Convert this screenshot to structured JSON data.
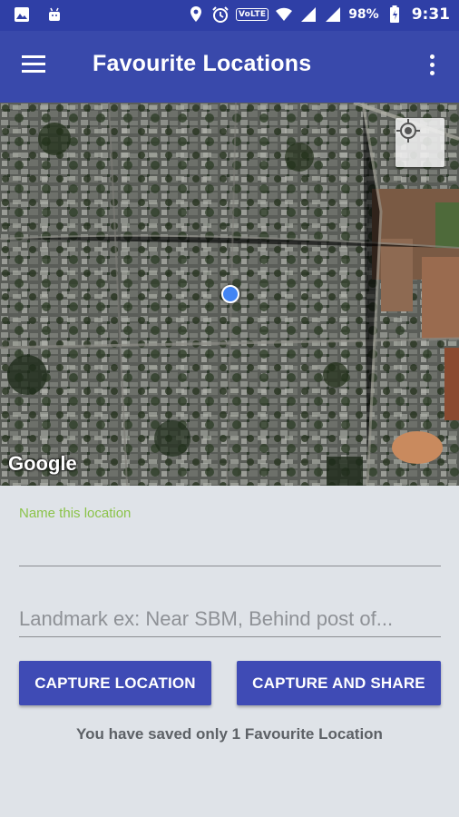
{
  "status_bar": {
    "icons_left": [
      "image-icon",
      "android-icon"
    ],
    "icons_right": [
      "location-icon",
      "alarm-icon",
      "volte-icon",
      "wifi-icon",
      "signal-icon",
      "signal-icon",
      "battery-icon"
    ],
    "volte_label": "VoLTE",
    "battery": "98%",
    "time": "9:31"
  },
  "app_bar": {
    "title": "Favourite Locations"
  },
  "map": {
    "attribution": "Google"
  },
  "form": {
    "name_label": "Name this location",
    "name_value": "",
    "landmark_placeholder": "Landmark ex: Near SBM, Behind post of...",
    "capture_button": "CAPTURE LOCATION",
    "share_button": "CAPTURE AND SHARE",
    "saved_message": "You have saved only 1 Favourite Location"
  },
  "colors": {
    "status_bar": "#2f3fa6",
    "app_bar": "#3949ab",
    "button": "#3f4bb5",
    "label_accent": "#8bc34a",
    "background": "#dfe3e8"
  }
}
